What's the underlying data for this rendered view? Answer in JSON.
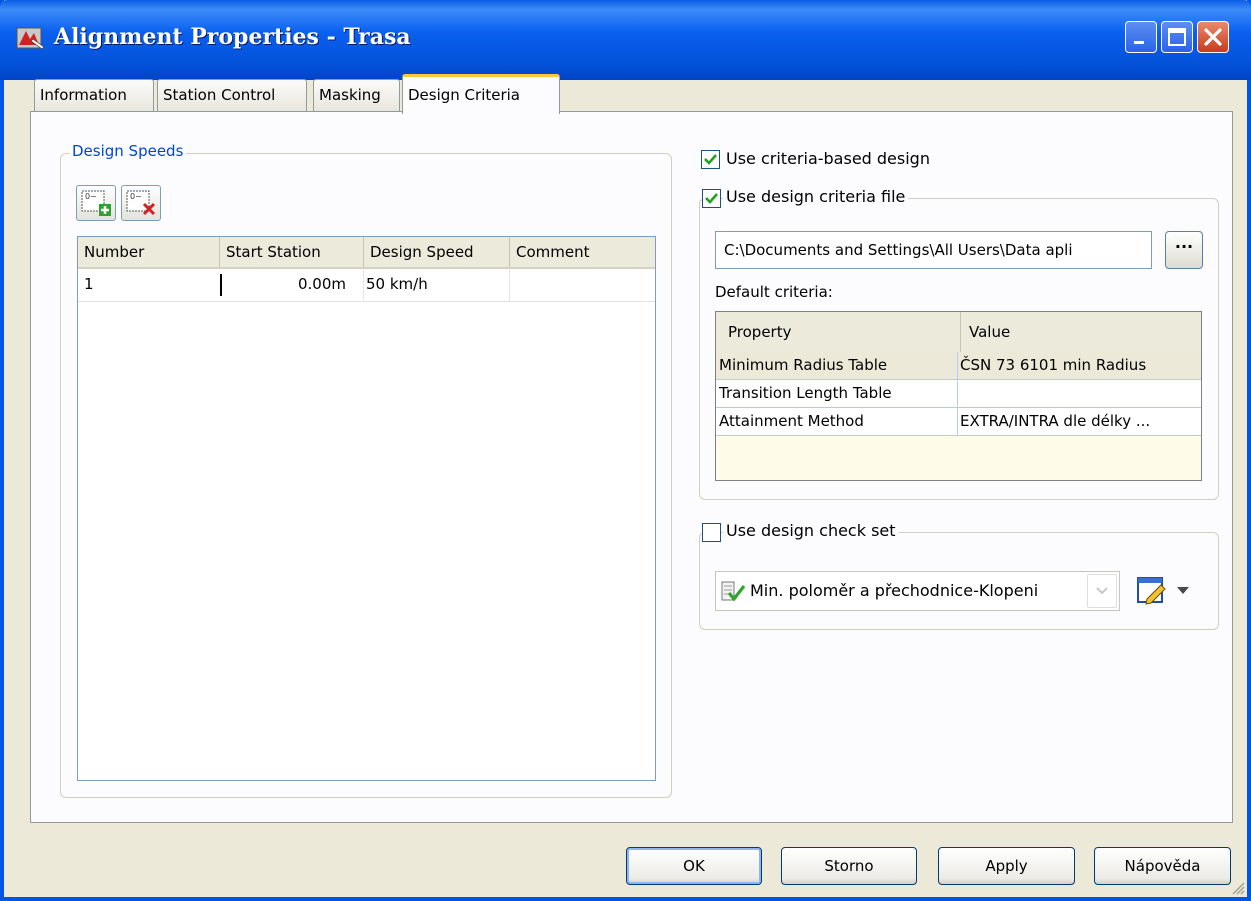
{
  "window": {
    "title": "Alignment Properties - Trasa",
    "caption_buttons": [
      "minimize-icon",
      "maximize-icon",
      "close-icon"
    ]
  },
  "tabs": [
    {
      "label": "Information"
    },
    {
      "label": "Station Control"
    },
    {
      "label": "Masking"
    },
    {
      "label": "Design Criteria",
      "active": true
    }
  ],
  "design_speeds": {
    "legend": "Design Speeds",
    "toolbar": [
      "add-speed-icon",
      "delete-speed-icon"
    ],
    "columns": [
      "Number",
      "Start Station",
      "Design Speed",
      "Comment"
    ],
    "rows": [
      {
        "number": "1",
        "start_station": "0.00m",
        "design_speed": "50 km/h",
        "comment": ""
      }
    ]
  },
  "criteria": {
    "use_criteria_based_design": {
      "label": "Use criteria-based design",
      "checked": true
    },
    "use_design_criteria_file": {
      "label": "Use design criteria file",
      "checked": true
    },
    "file_path": "C:\\Documents and Settings\\All Users\\Data apli",
    "browse_label": "···",
    "default_criteria_label": "Default criteria:",
    "table_columns": [
      "Property",
      "Value"
    ],
    "table_rows": [
      {
        "property": "Minimum Radius Table",
        "value": "ČSN 73 6101 min Radius"
      },
      {
        "property": "Transition Length Table",
        "value": ""
      },
      {
        "property": "Attainment Method",
        "value": "EXTRA/INTRA dle délky ..."
      }
    ]
  },
  "check_set": {
    "use_design_check_set": {
      "label": "Use design check set",
      "checked": false
    },
    "selected": "Min. poloměr a přechodnice-Klopeni"
  },
  "buttons": {
    "ok": "OK",
    "cancel": "Storno",
    "apply": "Apply",
    "help": "Nápověda"
  },
  "colors": {
    "titlebar": "#0a5ee6",
    "legend_text": "#0046d5",
    "active_tab_accent": "#ffc83c",
    "checkmark": "#21a121"
  }
}
